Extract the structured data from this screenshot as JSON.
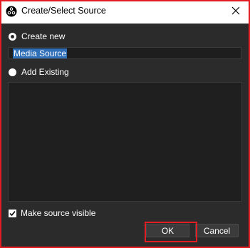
{
  "window": {
    "title": "Create/Select Source",
    "app_icon": "obs-icon",
    "close_icon": "close-icon"
  },
  "create_new": {
    "label": "Create new",
    "selected": true,
    "name_value": "Media Source"
  },
  "add_existing": {
    "label": "Add Existing",
    "selected": false,
    "items": []
  },
  "visibility": {
    "label": "Make source visible",
    "checked": true
  },
  "buttons": {
    "ok_label": "OK",
    "cancel_label": "Cancel"
  },
  "colors": {
    "background": "#2b2b2b",
    "highlight": "#e31b23",
    "selection": "#2f6fb8"
  }
}
